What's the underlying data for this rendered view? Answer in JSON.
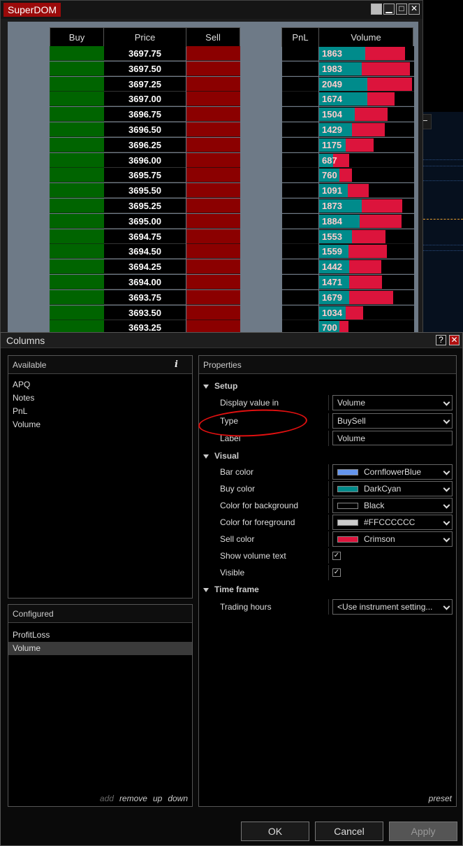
{
  "superdom": {
    "title": "SuperDOM",
    "headers": {
      "buy": "Buy",
      "price": "Price",
      "sell": "Sell",
      "pnl": "PnL",
      "volume": "Volume"
    },
    "rows": [
      {
        "price": "3697.75",
        "volume": "1863",
        "buy_frac": 0.66,
        "sell_frac": 0.57
      },
      {
        "price": "3697.50",
        "volume": "1983",
        "buy_frac": 0.61,
        "sell_frac": 0.69
      },
      {
        "price": "3697.25",
        "volume": "2049",
        "buy_frac": 0.69,
        "sell_frac": 0.64
      },
      {
        "price": "3697.00",
        "volume": "1674",
        "buy_frac": 0.69,
        "sell_frac": 0.39
      },
      {
        "price": "3696.75",
        "volume": "1504",
        "buy_frac": 0.51,
        "sell_frac": 0.47
      },
      {
        "price": "3696.50",
        "volume": "1429",
        "buy_frac": 0.47,
        "sell_frac": 0.47
      },
      {
        "price": "3696.25",
        "volume": "1175",
        "buy_frac": 0.38,
        "sell_frac": 0.4
      },
      {
        "price": "3696.00",
        "volume": "687",
        "buy_frac": 0.2,
        "sell_frac": 0.23
      },
      {
        "price": "3695.75",
        "volume": "760",
        "buy_frac": 0.29,
        "sell_frac": 0.18
      },
      {
        "price": "3695.50",
        "volume": "1091",
        "buy_frac": 0.41,
        "sell_frac": 0.3
      },
      {
        "price": "3695.25",
        "volume": "1873",
        "buy_frac": 0.61,
        "sell_frac": 0.58
      },
      {
        "price": "3695.00",
        "volume": "1884",
        "buy_frac": 0.58,
        "sell_frac": 0.6
      },
      {
        "price": "3694.75",
        "volume": "1553",
        "buy_frac": 0.47,
        "sell_frac": 0.48
      },
      {
        "price": "3694.50",
        "volume": "1559",
        "buy_frac": 0.42,
        "sell_frac": 0.55
      },
      {
        "price": "3694.25",
        "volume": "1442",
        "buy_frac": 0.43,
        "sell_frac": 0.46
      },
      {
        "price": "3694.00",
        "volume": "1471",
        "buy_frac": 0.43,
        "sell_frac": 0.47
      },
      {
        "price": "3693.75",
        "volume": "1679",
        "buy_frac": 0.43,
        "sell_frac": 0.63
      },
      {
        "price": "3693.50",
        "volume": "1034",
        "buy_frac": 0.38,
        "sell_frac": 0.25
      },
      {
        "price": "3693.25",
        "volume": "700",
        "buy_frac": 0.29,
        "sell_frac": 0.13
      }
    ]
  },
  "dialog": {
    "title": "Columns",
    "help_btn": "?",
    "close_btn": "✕",
    "available": {
      "header": "Available",
      "info_icon": "i",
      "items": [
        "APQ",
        "Notes",
        "PnL",
        "Volume"
      ]
    },
    "configured": {
      "header": "Configured",
      "items": [
        "ProfitLoss",
        "Volume"
      ],
      "selected_index": 1,
      "actions": {
        "add": "add",
        "remove": "remove",
        "up": "up",
        "down": "down"
      }
    },
    "properties": {
      "header": "Properties",
      "setup": {
        "title": "Setup",
        "display_value_in": {
          "label": "Display value in",
          "value": "Volume"
        },
        "type": {
          "label": "Type",
          "value": "BuySell"
        },
        "label": {
          "label": "Label",
          "value": "Volume"
        }
      },
      "visual": {
        "title": "Visual",
        "bar_color": {
          "label": "Bar color",
          "value": "CornflowerBlue",
          "color": "#6495ed"
        },
        "buy_color": {
          "label": "Buy color",
          "value": "DarkCyan",
          "color": "#008b8b"
        },
        "background_color": {
          "label": "Color for background",
          "value": "Black",
          "color": "#000000"
        },
        "foreground_color": {
          "label": "Color for foreground",
          "value": "#FFCCCCCC",
          "color": "#cccccc"
        },
        "sell_color": {
          "label": "Sell color",
          "value": "Crimson",
          "color": "#dc143c"
        },
        "show_volume_text": {
          "label": "Show volume text",
          "checked": true
        },
        "visible": {
          "label": "Visible",
          "checked": true
        }
      },
      "time_frame": {
        "title": "Time frame",
        "trading_hours": {
          "label": "Trading hours",
          "value": "<Use instrument setting..."
        }
      },
      "preset": "preset"
    },
    "buttons": {
      "ok": "OK",
      "cancel": "Cancel",
      "apply": "Apply"
    }
  }
}
